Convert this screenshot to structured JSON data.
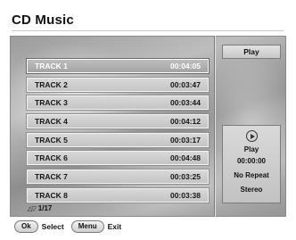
{
  "header": {
    "title": "CD Music"
  },
  "tracks": [
    {
      "name": "TRACK 1",
      "time": "00:04:05",
      "selected": true
    },
    {
      "name": "TRACK 2",
      "time": "00:03:47"
    },
    {
      "name": "TRACK 3",
      "time": "00:03:44"
    },
    {
      "name": "TRACK 4",
      "time": "00:04:12"
    },
    {
      "name": "TRACK 5",
      "time": "00:03:17"
    },
    {
      "name": "TRACK 6",
      "time": "00:04:48"
    },
    {
      "name": "TRACK 7",
      "time": "00:03:25"
    },
    {
      "name": "TRACK 8",
      "time": "00:03:38"
    }
  ],
  "pagination": {
    "arrows": "△▽",
    "page": "1/17"
  },
  "side_panel": {
    "play_button": "Play",
    "status_icon": "play-circle-icon",
    "status": "Play",
    "elapsed": "00:00:00",
    "repeat": "No Repeat",
    "audio": "Stereo"
  },
  "footer": {
    "ok_key": "Ok",
    "ok_label": "Select",
    "menu_key": "Menu",
    "menu_label": "Exit"
  }
}
